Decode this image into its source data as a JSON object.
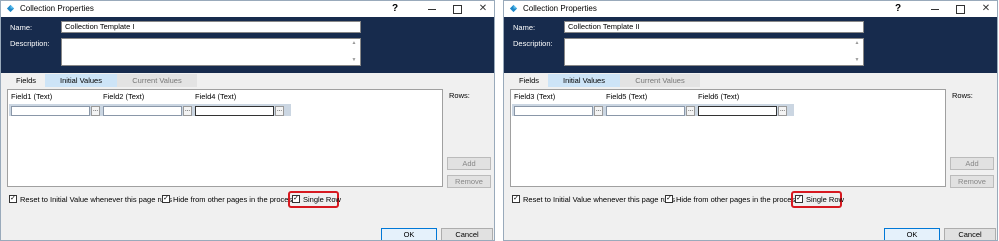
{
  "dialogs": [
    {
      "title": "Collection Properties",
      "help_label": "?",
      "close_label": "✕",
      "name_label": "Name:",
      "name_value": "Collection Template I",
      "description_label": "Description:",
      "description_value": "",
      "tabs": [
        "Fields",
        "Initial Values",
        "Current Values"
      ],
      "active_tab": "Initial Values",
      "columns": [
        "Field1  (Text)",
        "Field2  (Text)",
        "Field4  (Text)"
      ],
      "browse_label": "...",
      "rows_label": "Rows:",
      "add_label": "Add",
      "remove_label": "Remove",
      "checkboxes": [
        {
          "label": "Reset to Initial Value whenever this page runs",
          "checked": true
        },
        {
          "label": "Hide from other pages in the process",
          "checked": true
        },
        {
          "label": "Single Row",
          "checked": true
        }
      ],
      "ok_label": "OK",
      "cancel_label": "Cancel"
    },
    {
      "title": "Collection Properties",
      "help_label": "?",
      "close_label": "✕",
      "name_label": "Name:",
      "name_value": "Collection Template II",
      "description_label": "Description:",
      "description_value": "",
      "tabs": [
        "Fields",
        "Initial Values",
        "Current Values"
      ],
      "active_tab": "Initial Values",
      "columns": [
        "Field3  (Text)",
        "Field5  (Text)",
        "Field6  (Text)"
      ],
      "browse_label": "...",
      "rows_label": "Rows:",
      "add_label": "Add",
      "remove_label": "Remove",
      "checkboxes": [
        {
          "label": "Reset to Initial Value whenever this page runs",
          "checked": true
        },
        {
          "label": "Hide from other pages in the process",
          "checked": true
        },
        {
          "label": "Single Row",
          "checked": true
        }
      ],
      "ok_label": "OK",
      "cancel_label": "Cancel"
    }
  ],
  "colors": {
    "header_bg": "#172b4d",
    "highlight": "#d71920",
    "active_tab": "#cde4f7"
  },
  "icons": {
    "app": "app-logo-icon",
    "minimize": "minimize-icon",
    "maximize": "maximize-icon",
    "close": "close-icon",
    "check": "checkmark-icon"
  }
}
